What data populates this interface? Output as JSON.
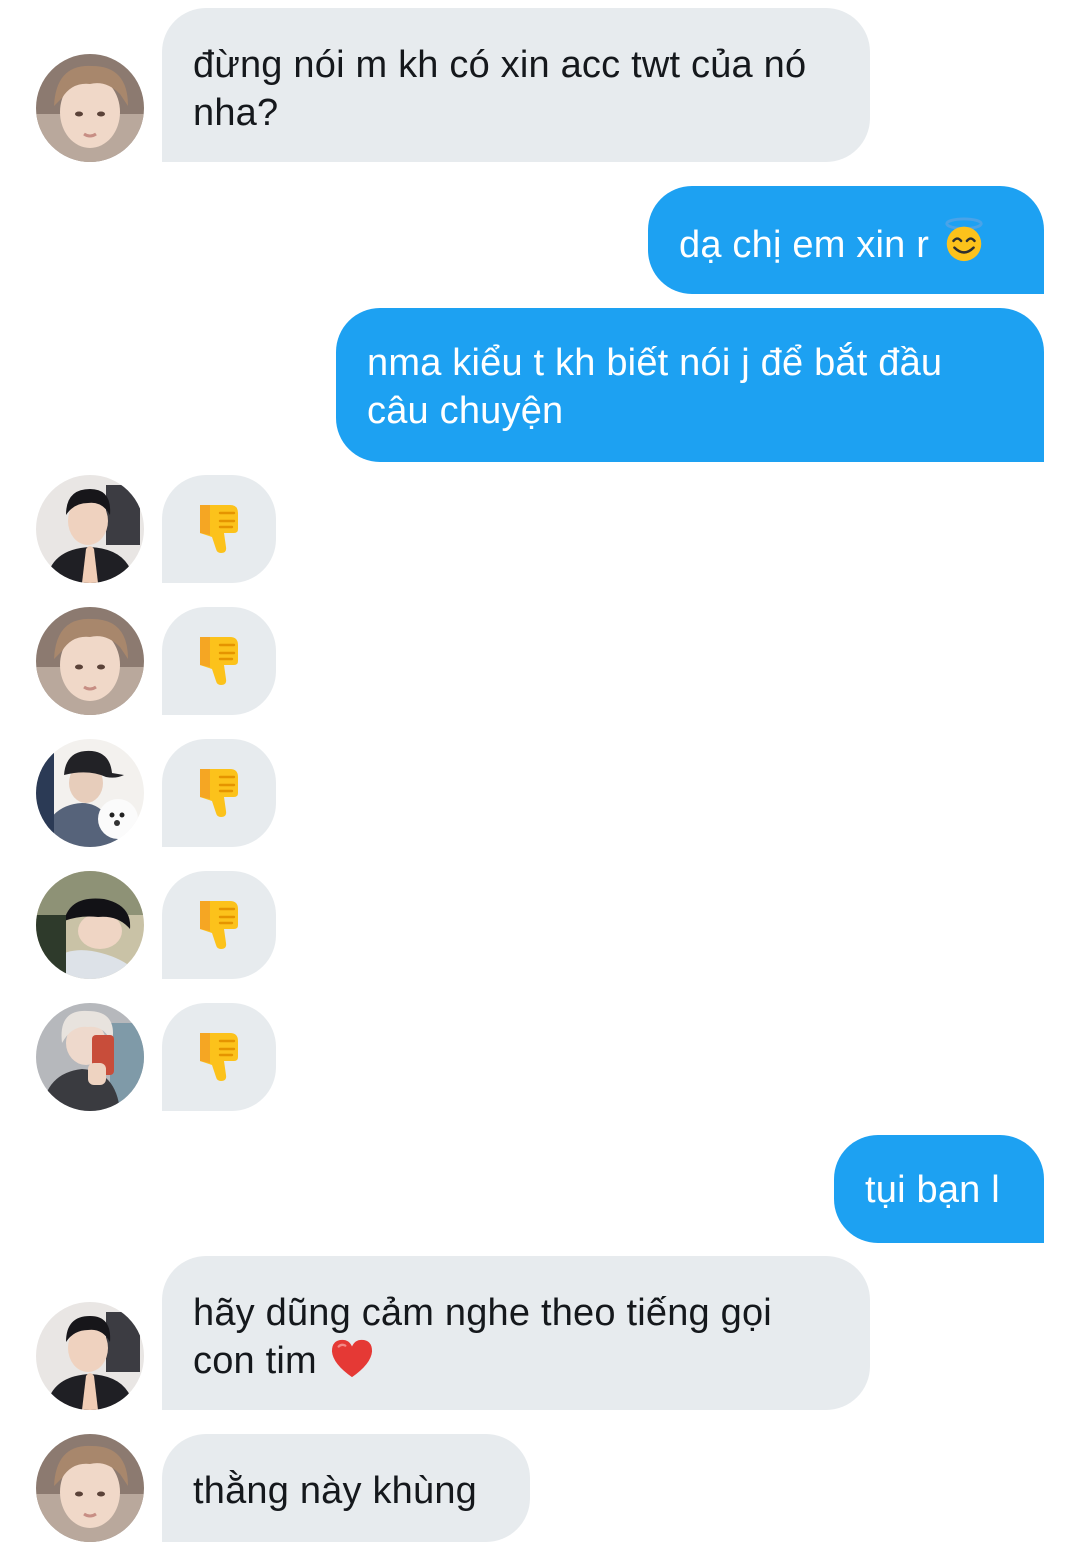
{
  "messages": [
    {
      "id": "m1",
      "direction": "incoming",
      "sender_avatar": "avatar-a",
      "text": "đừng nói m kh có xin acc twt của nó nha?"
    },
    {
      "id": "m2",
      "direction": "outgoing",
      "text": "dạ chị em xin r",
      "emoji": "smiling-face-with-halo"
    },
    {
      "id": "m3",
      "direction": "outgoing",
      "text": "nma kiểu t kh biết nói j để bắt đầu câu chuyện"
    },
    {
      "id": "m4",
      "direction": "incoming",
      "sender_avatar": "avatar-b",
      "emoji": "thumbs-down"
    },
    {
      "id": "m5",
      "direction": "incoming",
      "sender_avatar": "avatar-a",
      "emoji": "thumbs-down"
    },
    {
      "id": "m6",
      "direction": "incoming",
      "sender_avatar": "avatar-c",
      "emoji": "thumbs-down"
    },
    {
      "id": "m7",
      "direction": "incoming",
      "sender_avatar": "avatar-d",
      "emoji": "thumbs-down"
    },
    {
      "id": "m8",
      "direction": "incoming",
      "sender_avatar": "avatar-e",
      "emoji": "thumbs-down"
    },
    {
      "id": "m9",
      "direction": "outgoing",
      "text": "tụi bạn l"
    },
    {
      "id": "m10",
      "direction": "incoming",
      "sender_avatar": "avatar-b",
      "text": "hãy dũng cảm nghe theo tiếng gọi con tim",
      "emoji": "red-heart"
    },
    {
      "id": "m11",
      "direction": "incoming",
      "sender_avatar": "avatar-a",
      "text": "thằng này khùng"
    }
  ],
  "colors": {
    "incoming_bubble": "#e7ebee",
    "outgoing_bubble": "#1da1f2",
    "incoming_text": "#15181c",
    "outgoing_text": "#ffffff"
  }
}
